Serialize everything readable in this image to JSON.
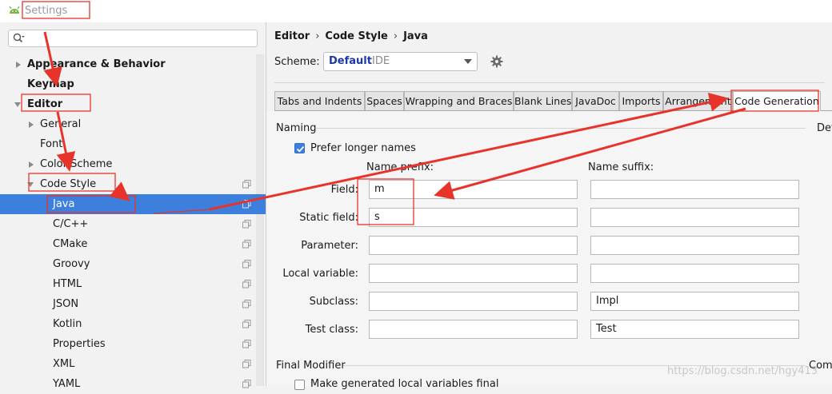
{
  "window": {
    "title": "Settings"
  },
  "search": {
    "placeholder": ""
  },
  "tree": {
    "items": [
      {
        "label": "Appearance & Behavior"
      },
      {
        "label": "Keymap"
      },
      {
        "label": "Editor"
      },
      {
        "label": "General"
      },
      {
        "label": "Font"
      },
      {
        "label": "Color Scheme"
      },
      {
        "label": "Code Style"
      },
      {
        "label": "Java"
      },
      {
        "label": "C/C++"
      },
      {
        "label": "CMake"
      },
      {
        "label": "Groovy"
      },
      {
        "label": "HTML"
      },
      {
        "label": "JSON"
      },
      {
        "label": "Kotlin"
      },
      {
        "label": "Properties"
      },
      {
        "label": "XML"
      },
      {
        "label": "YAML"
      }
    ]
  },
  "breadcrumb": {
    "items": [
      "Editor",
      "Code Style",
      "Java"
    ],
    "separator": "›"
  },
  "scheme": {
    "label": "Scheme:",
    "value": "Default",
    "scope": "IDE"
  },
  "tabs": [
    {
      "label": "Tabs and Indents"
    },
    {
      "label": "Spaces"
    },
    {
      "label": "Wrapping and Braces"
    },
    {
      "label": "Blank Lines"
    },
    {
      "label": "JavaDoc"
    },
    {
      "label": "Imports"
    },
    {
      "label": "Arrangement"
    },
    {
      "label": "Code Generation",
      "active": true
    }
  ],
  "naming": {
    "section": "Naming",
    "right_section": "Defa",
    "prefer_longer": {
      "label": "Prefer longer names",
      "checked": true
    },
    "prefix_header": "Name prefix:",
    "suffix_header": "Name suffix:",
    "rows": [
      {
        "label": "Field:",
        "prefix": "m",
        "suffix": ""
      },
      {
        "label": "Static field:",
        "prefix": "s",
        "suffix": ""
      },
      {
        "label": "Parameter:",
        "prefix": "",
        "suffix": ""
      },
      {
        "label": "Local variable:",
        "prefix": "",
        "suffix": ""
      },
      {
        "label": "Subclass:",
        "prefix": "",
        "suffix": "Impl"
      },
      {
        "label": "Test class:",
        "prefix": "",
        "suffix": "Test"
      }
    ]
  },
  "final_modifier": {
    "section": "Final Modifier",
    "right_section": "Comm",
    "make_local_final": {
      "label": "Make generated local variables final",
      "checked": false
    }
  },
  "watermark": "https://blog.csdn.net/hgy413",
  "colors": {
    "selection": "#3d7fdc",
    "annotation": "#e8332a",
    "scheme_value": "#1b3aa8"
  }
}
